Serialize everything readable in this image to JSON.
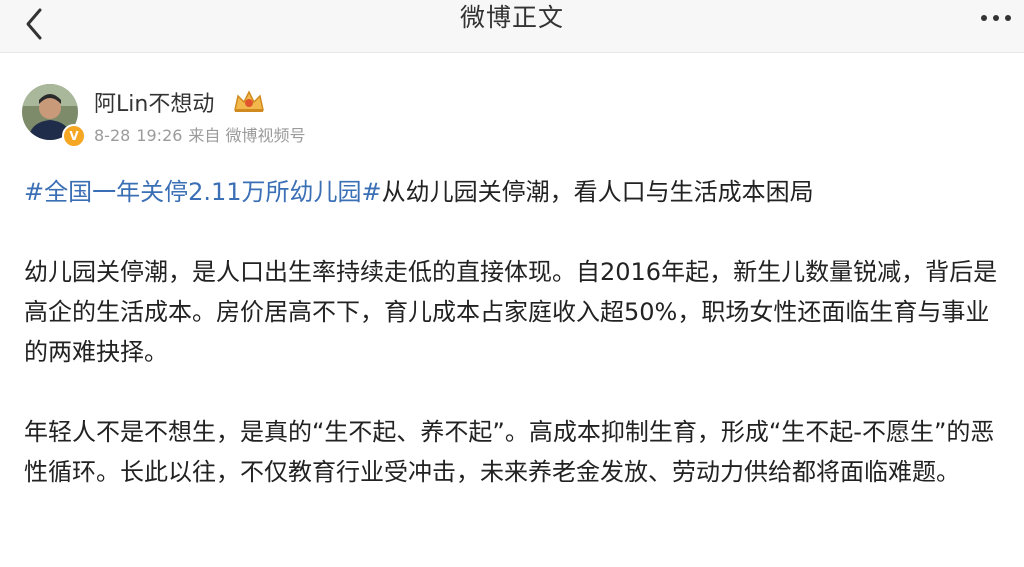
{
  "navbar": {
    "title": "微博正文",
    "back_icon": "chevron-left-icon",
    "more_icon": "more-dots-icon"
  },
  "author": {
    "name": "阿Lin不想动",
    "date": "8-28",
    "time": "19:26",
    "source": "来自 微博视频号",
    "verified_mark": "V",
    "badge_icon": "crown-icon"
  },
  "post": {
    "topic": "#全国一年关停2.11万所幼儿园#",
    "topic_rest": "从幼儿园关停潮，看人口与生活成本困局",
    "paragraphs": [
      "幼儿园关停潮，是人口出生率持续走低的直接体现。自2016年起，新生儿数量锐减，背后是高企的生活成本。房价居高不下，育儿成本占家庭收入超50%，职场女性还面临生育与事业的两难抉择。",
      "年轻人不是不想生，是真的“生不起、养不起”。高成本抑制生育，形成“生不起-不愿生”的恶性循环。长此以往，不仅教育行业受冲击，未来养老金发放、劳动力供给都将面临难题。"
    ]
  },
  "colors": {
    "topic": "#3a6fb5",
    "badge": "#f5a623",
    "meta": "#9b9b9b"
  }
}
